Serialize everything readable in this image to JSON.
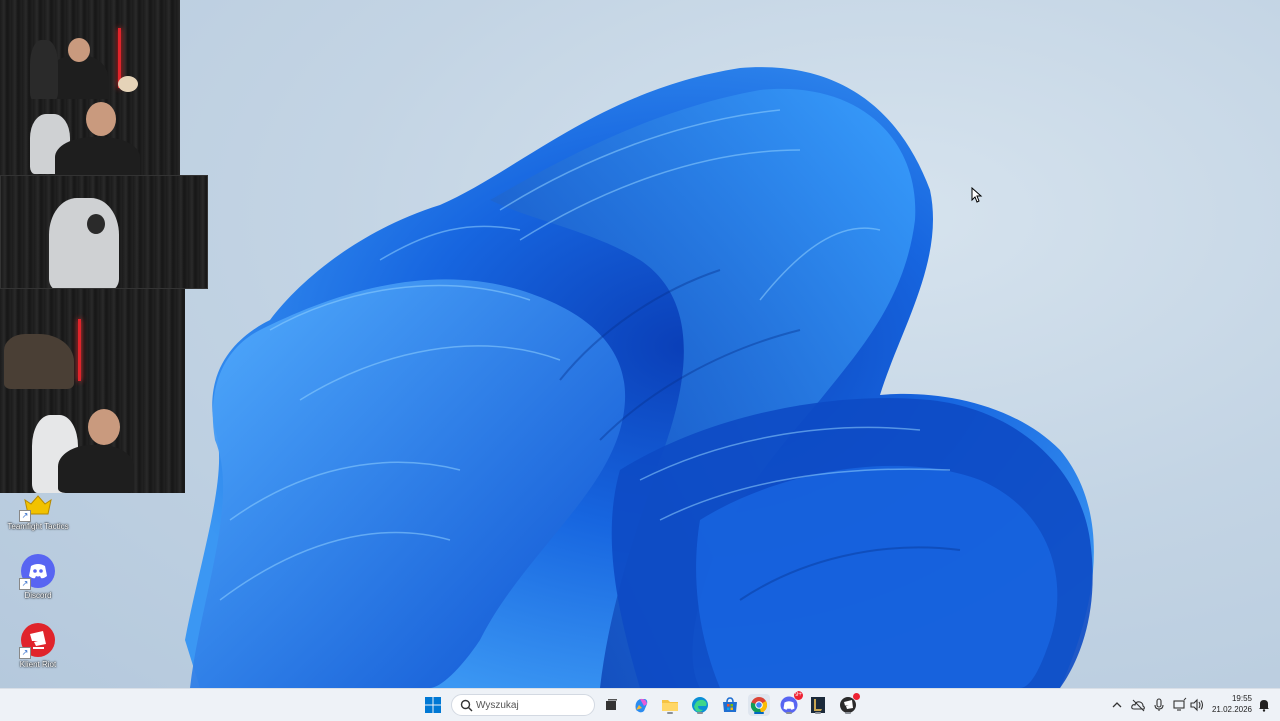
{
  "desktop_icons": [
    {
      "label": "Teamfight Tactics",
      "icon": "tft-icon"
    },
    {
      "label": "Discord",
      "icon": "discord-icon"
    },
    {
      "label": "Klient Riot",
      "icon": "riot-client-icon"
    }
  ],
  "webcam_feeds": [
    "webcam-feed-1",
    "webcam-feed-2",
    "webcam-feed-3",
    "webcam-feed-4",
    "webcam-feed-5"
  ],
  "taskbar": {
    "search_placeholder": "Wyszukaj",
    "apps": [
      "start",
      "search",
      "task-view",
      "copilot",
      "file-explorer",
      "edge",
      "store",
      "chrome",
      "discord",
      "league",
      "riot"
    ],
    "discord_badge": "9+"
  },
  "tray": {
    "time": "19:55",
    "date": "21.02.2026"
  },
  "colors": {
    "wallpaper_bloom": "#1a73e8",
    "taskbar_bg": "#eef2f7",
    "accent": "#0067c0"
  }
}
